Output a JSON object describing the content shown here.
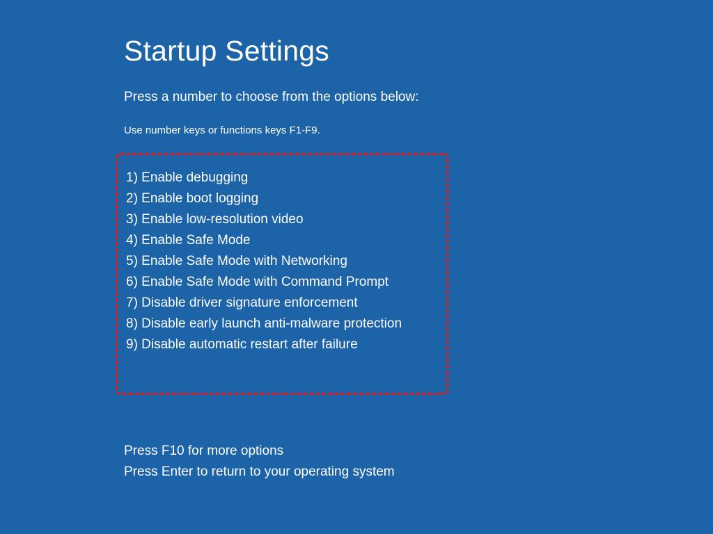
{
  "title": "Startup Settings",
  "prompt": "Press a number to choose from the options below:",
  "hint": "Use number keys or functions keys F1-F9.",
  "options": [
    "1) Enable debugging",
    "2) Enable boot logging",
    "3) Enable low-resolution video",
    "4) Enable Safe Mode",
    "5) Enable Safe Mode with Networking",
    "6) Enable Safe Mode with Command Prompt",
    "7) Disable driver signature enforcement",
    "8) Disable early launch anti-malware protection",
    "9) Disable automatic restart after failure"
  ],
  "footer": {
    "more": "Press F10 for more options",
    "return": "Press Enter to return to your operating system"
  }
}
